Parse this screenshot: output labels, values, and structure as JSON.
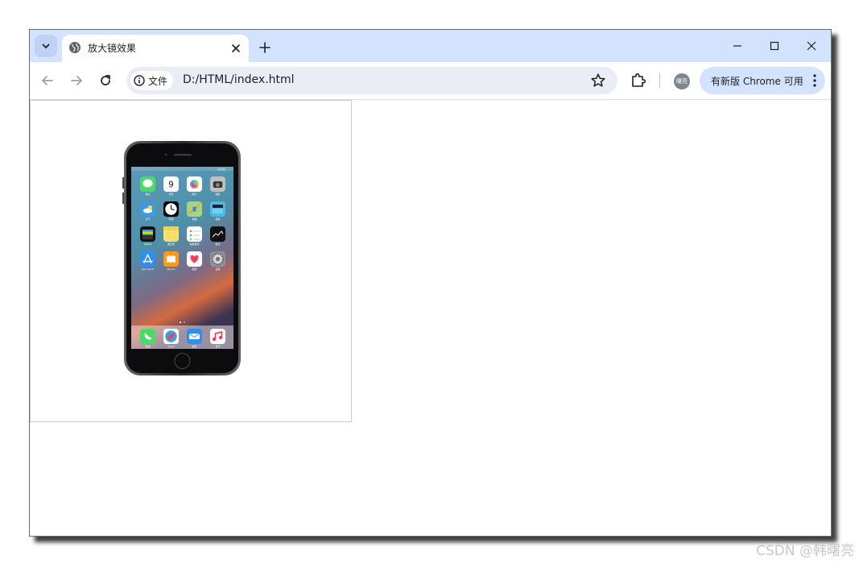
{
  "browser": {
    "tab_title": "放大镜效果",
    "new_tab_symbol": "+",
    "address_chip_label": "文件",
    "url": "D:/HTML/index.html",
    "avatar_text": "曙亮",
    "update_button_label": "有新版 Chrome 可用"
  },
  "phone": {
    "status_bar": {
      "battery": "100%"
    },
    "apps": [
      {
        "label": "信息",
        "color": "#4cd964",
        "icon": "message-bubble"
      },
      {
        "label": "日历",
        "color": "#ffffff",
        "icon": "calendar",
        "text": "9"
      },
      {
        "label": "照片",
        "color": "#ffffff",
        "icon": "photos-flower"
      },
      {
        "label": "相机",
        "color": "#bfbfbf",
        "icon": "camera"
      },
      {
        "label": "天气",
        "color": "#3f9ae0",
        "icon": "weather-cloud"
      },
      {
        "label": "时钟",
        "color": "#000000",
        "icon": "clock"
      },
      {
        "label": "地图",
        "color": "#a8d47f",
        "icon": "map"
      },
      {
        "label": "视频",
        "color": "#4fb7e8",
        "icon": "clapper"
      },
      {
        "label": "Wallet",
        "color": "#111111",
        "icon": "wallet"
      },
      {
        "label": "备忘录",
        "color": "#fbe46a",
        "icon": "notes"
      },
      {
        "label": "提醒事项",
        "color": "#ffffff",
        "icon": "reminders"
      },
      {
        "label": "股市",
        "color": "#111111",
        "icon": "stocks"
      },
      {
        "label": "App Store",
        "color": "#2f8ff0",
        "icon": "app-store"
      },
      {
        "label": "iBooks",
        "color": "#ff9a16",
        "icon": "book"
      },
      {
        "label": "健康",
        "color": "#ffffff",
        "icon": "heart"
      },
      {
        "label": "设置",
        "color": "#8e8e93",
        "icon": "gear"
      }
    ],
    "dock": [
      {
        "label": "电话",
        "color": "#4cd964",
        "icon": "phone"
      },
      {
        "label": "Safari",
        "color": "#ffffff",
        "icon": "compass"
      },
      {
        "label": "邮件",
        "color": "#2f8ff0",
        "icon": "mail"
      },
      {
        "label": "音乐",
        "color": "#ffffff",
        "icon": "music-note"
      }
    ]
  },
  "watermark": "CSDN @韩曙亮"
}
